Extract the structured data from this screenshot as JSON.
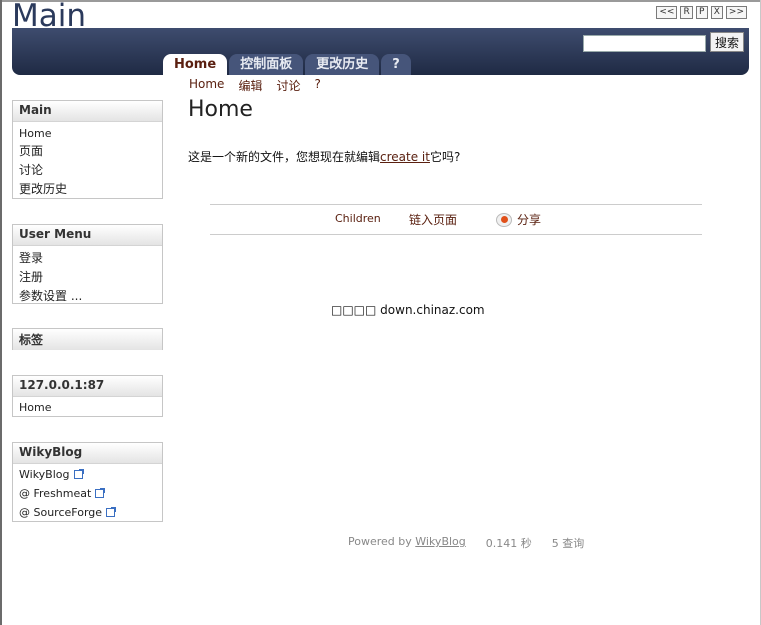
{
  "site": {
    "title": "Main"
  },
  "pager": [
    "<<",
    "R",
    "P",
    "X",
    ">>"
  ],
  "search": {
    "value": "",
    "button_label": "搜索"
  },
  "tabs": [
    {
      "label": "Home",
      "active": true
    },
    {
      "label": "控制面板",
      "active": false
    },
    {
      "label": "更改历史",
      "active": false
    },
    {
      "label": "?",
      "active": false
    }
  ],
  "subnav": [
    "Home",
    "编辑",
    "讨论",
    "?"
  ],
  "sidebar": {
    "main": {
      "title": "Main",
      "items": [
        "Home",
        "页面",
        "讨论",
        "更改历史"
      ]
    },
    "user_menu": {
      "title": "User Menu",
      "items": [
        "登录",
        "注册",
        "参数设置 ..."
      ]
    },
    "tags": {
      "title": "标签"
    },
    "host": {
      "title": "127.0.0.1:87",
      "items": [
        "Home"
      ]
    },
    "wikyblog": {
      "title": "WikyBlog",
      "items": [
        "WikyBlog",
        "@ Freshmeat",
        "@ SourceForge"
      ]
    }
  },
  "content": {
    "title": "Home",
    "text_before": "这是一个新的文件，您想现在就编辑",
    "create_link": "create it",
    "text_after": "它吗?"
  },
  "child_bar": {
    "children": "Children",
    "links": "链入页面",
    "share": "分享"
  },
  "ad": {
    "text": "□□□□ down.chinaz.com"
  },
  "footer": {
    "powered_prefix": "Powered by ",
    "powered_link": "WikyBlog",
    "time": "0.141 秒",
    "queries": "5 查询"
  }
}
